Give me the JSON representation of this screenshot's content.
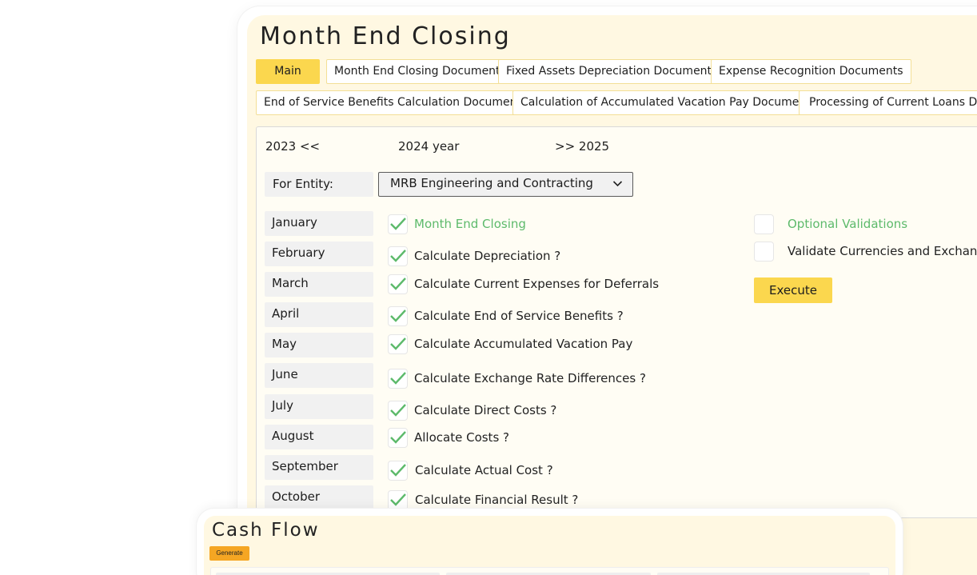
{
  "page": {
    "title": "Month End Closing"
  },
  "tabs": [
    {
      "label": "Main",
      "active": true
    },
    {
      "label": "Month End Closing Documents",
      "active": false
    },
    {
      "label": "Fixed Assets Depreciation Documents",
      "active": false
    },
    {
      "label": "Expense Recognition Documents",
      "active": false
    },
    {
      "label": "End of Service Benefits Calculation Documents",
      "active": false
    },
    {
      "label": "Calculation of Accumulated Vacation Pay Documents",
      "active": false
    },
    {
      "label": "Processing of Current Loans Docu",
      "active": false
    }
  ],
  "year_nav": {
    "prev_label": "2023 <<",
    "current_label": "2024 year",
    "next_label": ">> 2025"
  },
  "entity": {
    "label": "For Entity:",
    "value": "MRB Engineering and Contracting"
  },
  "months": [
    "January",
    "February",
    "March",
    "April",
    "May",
    "June",
    "July",
    "August",
    "September",
    "October"
  ],
  "tasks": [
    {
      "label": "Month End Closing",
      "checked": true
    },
    {
      "label": "Calculate Depreciation ?",
      "checked": true
    },
    {
      "label": "Calculate Current Expenses for Deferrals",
      "checked": true
    },
    {
      "label": "Calculate End of Service Benefits ?",
      "checked": true
    },
    {
      "label": "Calculate Accumulated Vacation Pay",
      "checked": true
    },
    {
      "label": "Calculate Exchange Rate Differences ?",
      "checked": true
    },
    {
      "label": "Calculate Direct Costs ?",
      "checked": true
    },
    {
      "label": "Allocate Costs ?",
      "checked": true
    },
    {
      "label": "Calculate Actual Cost ?",
      "checked": true
    },
    {
      "label": "Calculate Financial Result ?",
      "checked": true
    }
  ],
  "options": [
    {
      "label": "Optional Validations",
      "checked": false
    },
    {
      "label": "Validate Currencies and Exchange Ra",
      "checked": false
    }
  ],
  "execute_label": "Execute",
  "cash_flow": {
    "title": "Cash Flow",
    "generate_label": "Generate"
  },
  "colors": {
    "accent": "#fbd74e",
    "check_green": "#5dba6b",
    "panel_bg": "#fff8e2",
    "generate_orange": "#f5a623"
  }
}
